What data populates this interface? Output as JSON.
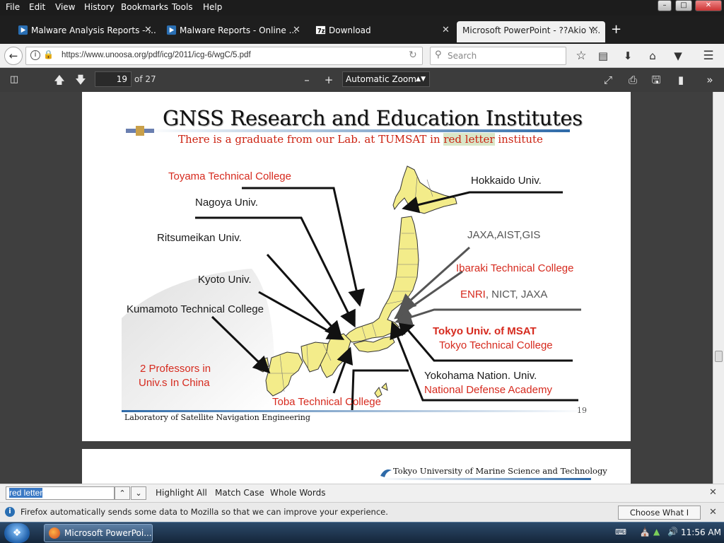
{
  "menubar": {
    "items": [
      "File",
      "Edit",
      "View",
      "History",
      "Bookmarks",
      "Tools",
      "Help"
    ]
  },
  "tabs": [
    {
      "label": "Malware Analysis Reports - ..."
    },
    {
      "label": "Malware Reports - Online ..."
    },
    {
      "label": "Download"
    },
    {
      "label": "Microsoft PowerPoint - ??Akio Y..."
    }
  ],
  "nav": {
    "url": "https://www.unoosa.org/pdf/icg/2011/icg-6/wgC/5.pdf",
    "search_placeholder": "Search"
  },
  "pdf": {
    "page_number": "19",
    "page_total": "of 27",
    "zoom": "Automatic Zoom"
  },
  "slide": {
    "title": "GNSS Research and Education Institutes",
    "subtitle_prefix": "There is a graduate from our Lab. at TUMSAT in ",
    "subtitle_highlight": "red letter",
    "subtitle_suffix": " institute",
    "labels": {
      "toyama": "Toyama Technical College",
      "nagoya": "Nagoya Univ.",
      "ritsumeikan": "Ritsumeikan Univ.",
      "kyoto": "Kyoto Univ.",
      "kumamoto": "Kumamoto Technical College",
      "professors_1": "2 Professors in",
      "professors_2": "Univ.s In China",
      "toba": "Toba Technical College",
      "hokkaido": "Hokkaido Univ.",
      "jaxa": "JAXA,AIST,GIS",
      "ibaraki": "Ibaraki Technical College",
      "enri": "ENRI",
      "enri_rest": ", NICT, JAXA",
      "tokyo_msat": "Tokyo Univ. of MSAT",
      "tokyo_tc": "Tokyo Technical College",
      "yokohama": "Yokohama Nation. Univ.",
      "nda": "National Defense Academy"
    },
    "footer_left": "Laboratory of Satellite Navigation Engineering",
    "slide_number": "19"
  },
  "page2": {
    "footer": "Tokyo University of Marine Science and Technology"
  },
  "findbar": {
    "query": "red letter",
    "highlight_all": "Highlight All",
    "match_case": "Match Case",
    "whole_words": "Whole Words"
  },
  "notification": {
    "message": "Firefox automatically sends some data to Mozilla so that we can improve your experience.",
    "button": "Choose What I Share"
  },
  "taskbar": {
    "app_label": "Microsoft PowerPoi...",
    "clock": "11:56 AM"
  }
}
